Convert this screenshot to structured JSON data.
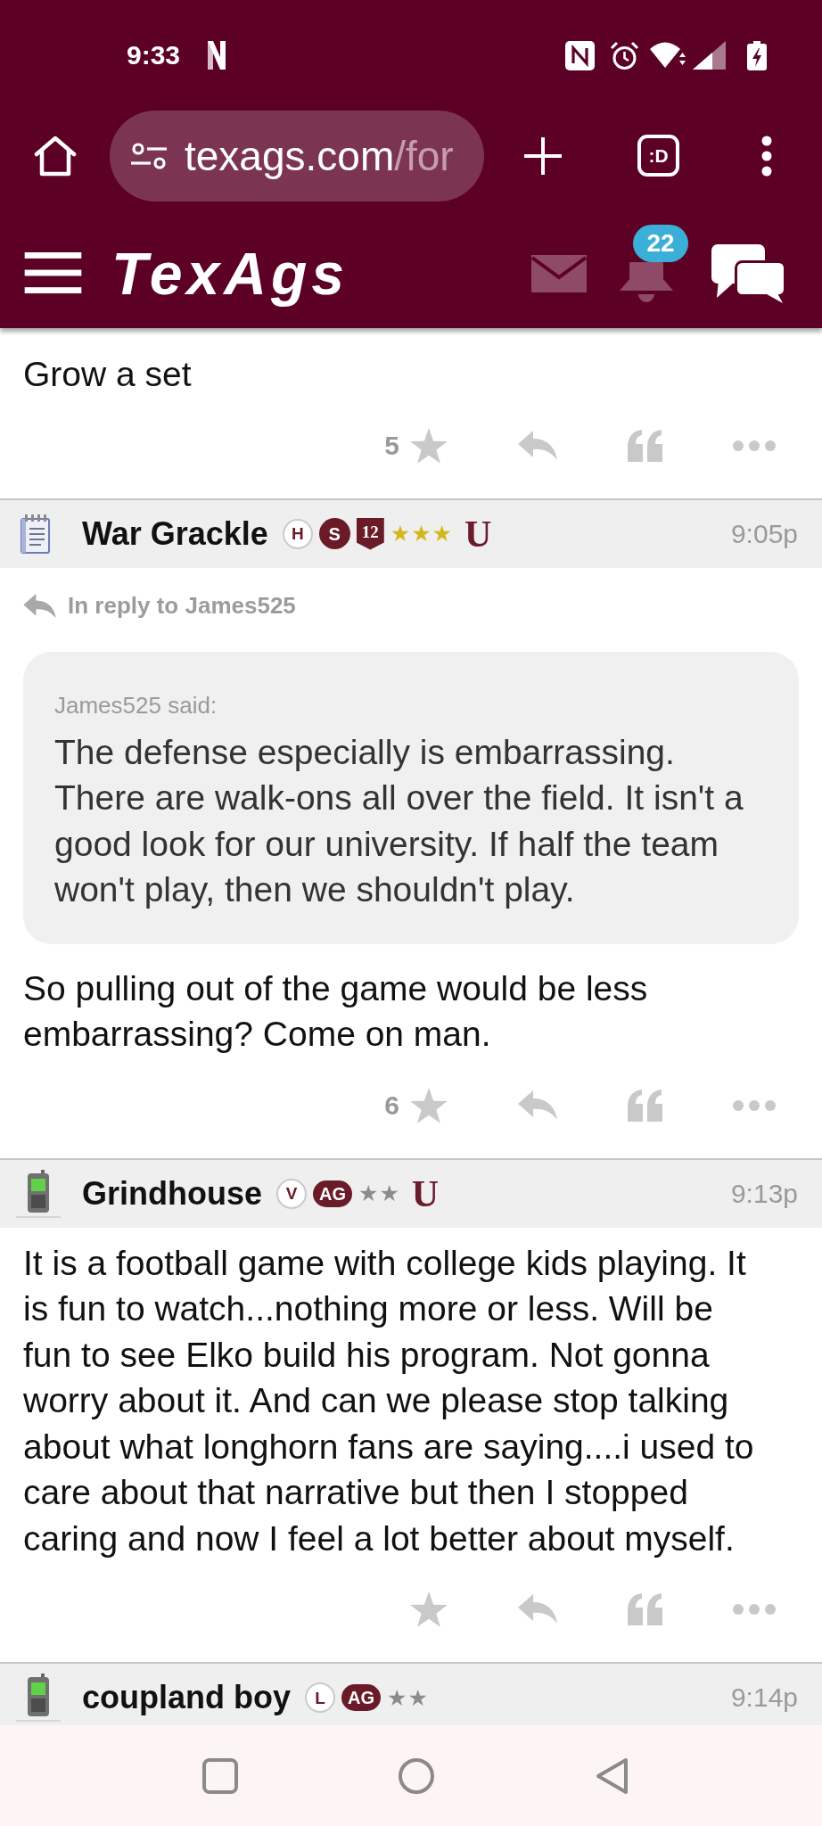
{
  "status_bar": {
    "time": "9:33"
  },
  "browser": {
    "url_host": "texags.com",
    "url_path": "/for",
    "tab_switcher": ":D"
  },
  "site_header": {
    "logo": "TexAgs",
    "notification_count": "22"
  },
  "posts": [
    {
      "body": "Grow a set",
      "star_count": "5"
    },
    {
      "header": {
        "avatar": {
          "kind": "notepad"
        },
        "username": "War Grackle",
        "badges": [
          {
            "kind": "ring",
            "text": "H"
          },
          {
            "kind": "disc",
            "text": "S"
          },
          {
            "kind": "shield",
            "text": "12"
          },
          {
            "kind": "stars",
            "text": "★★★",
            "color": "#d5b71c"
          },
          {
            "kind": "mark",
            "text": "U"
          }
        ],
        "time": "9:05p"
      },
      "in_reply_to": "In reply to James525",
      "quote": {
        "attribution": "James525 said:",
        "text": "The defense especially is embarrassing. There are walk-ons all over the field. It isn't a good look for our university. If half the team won't play, then we shouldn't play."
      },
      "body": "So pulling out of the game would be less embarrassing? Come on man.",
      "star_count": "6"
    },
    {
      "header": {
        "avatar": {
          "kind": "phone"
        },
        "username": "Grindhouse",
        "badges": [
          {
            "kind": "ring",
            "text": "V"
          },
          {
            "kind": "pill",
            "text": "AG"
          },
          {
            "kind": "stars",
            "text": "★★",
            "color": "#8c8c8c"
          },
          {
            "kind": "mark",
            "text": "U"
          }
        ],
        "time": "9:13p"
      },
      "body": "It is a football game with college kids playing. It is fun to watch...nothing more or less. Will be fun to see Elko build his program. Not gonna worry about it. And can we please stop talking about what longhorn fans are saying....i used to care about that narrative but then I stopped caring and now I feel a lot better about myself."
    },
    {
      "header": {
        "avatar": {
          "kind": "phone"
        },
        "username": "coupland boy",
        "badges": [
          {
            "kind": "ring",
            "text": "L"
          },
          {
            "kind": "pill",
            "text": "AG"
          },
          {
            "kind": "stars",
            "text": "★★",
            "color": "#8c8c8c"
          }
        ],
        "time": "9:14p"
      }
    }
  ]
}
